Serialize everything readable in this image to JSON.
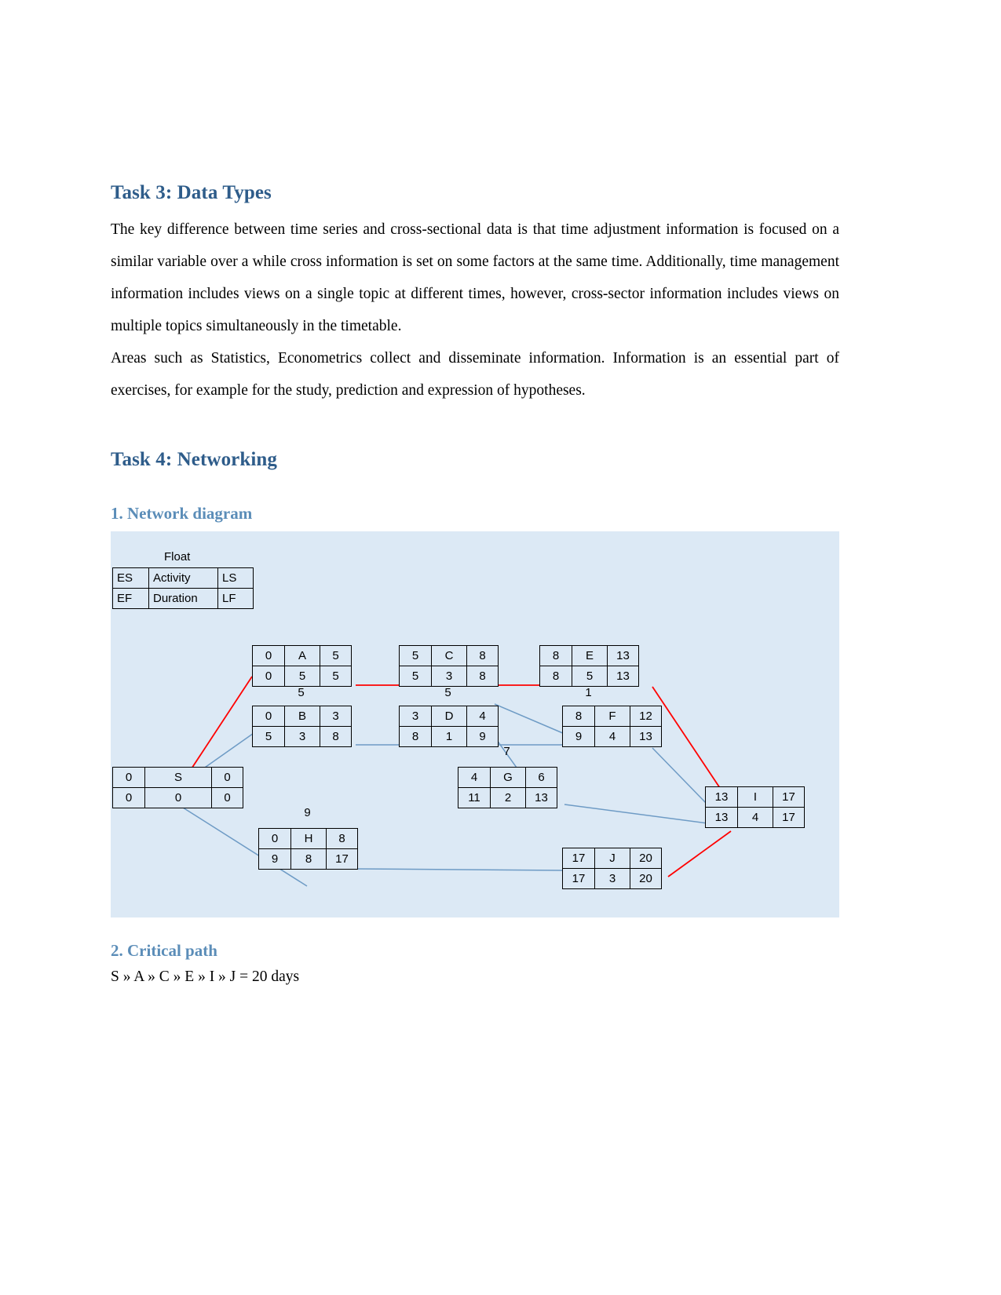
{
  "document": {
    "task3": {
      "heading": "Task 3: Data Types",
      "paragraph1": "The key difference between time series and cross-sectional data is that time adjustment information is focused on a similar variable over a while cross information is set on some factors at the same time. Additionally, time management information includes views on a single topic at different times, however, cross-sector information includes views on multiple topics simultaneously in the timetable.",
      "paragraph2": "Areas such as Statistics, Econometrics collect and disseminate information. Information is an essential part of exercises, for example for the study, prediction and expression of hypotheses."
    },
    "task4": {
      "heading": "Task 4: Networking",
      "section1_heading": "1. Network diagram",
      "section2_heading": "2. Critical path",
      "critical_path_text": "S » A » C » E » I » J = 20 days"
    }
  },
  "diagram": {
    "legend": {
      "float_label": "Float",
      "row1": [
        "ES",
        "Activity",
        "LS"
      ],
      "row2": [
        "EF",
        "Duration",
        "LF"
      ]
    },
    "colors": {
      "background": "#DCE9F5",
      "critical_edge": "#FF0000",
      "normal_edge": "#6E9BC5",
      "node_border": "#000000",
      "heading_primary": "#2E5C8A",
      "heading_secondary": "#5B8DB8"
    },
    "nodes": [
      {
        "id": "S",
        "es": "0",
        "activity": "S",
        "ls": "0",
        "ef": "0",
        "duration": "0",
        "lf": "0",
        "float": ""
      },
      {
        "id": "A",
        "es": "0",
        "activity": "A",
        "ls": "5",
        "ef": "0",
        "duration": "5",
        "lf": "5",
        "float": "5"
      },
      {
        "id": "B",
        "es": "0",
        "activity": "B",
        "ls": "3",
        "ef": "5",
        "duration": "3",
        "lf": "8",
        "float": ""
      },
      {
        "id": "C",
        "es": "5",
        "activity": "C",
        "ls": "8",
        "ef": "5",
        "duration": "3",
        "lf": "8",
        "float": "5"
      },
      {
        "id": "D",
        "es": "3",
        "activity": "D",
        "ls": "4",
        "ef": "8",
        "duration": "1",
        "lf": "9",
        "float": ""
      },
      {
        "id": "E",
        "es": "8",
        "activity": "E",
        "ls": "13",
        "ef": "8",
        "duration": "5",
        "lf": "13",
        "float": "1"
      },
      {
        "id": "F",
        "es": "8",
        "activity": "F",
        "ls": "12",
        "ef": "9",
        "duration": "4",
        "lf": "13",
        "float": ""
      },
      {
        "id": "G",
        "es": "4",
        "activity": "G",
        "ls": "6",
        "ef": "11",
        "duration": "2",
        "lf": "13",
        "float": "7"
      },
      {
        "id": "H",
        "es": "0",
        "activity": "H",
        "ls": "8",
        "ef": "9",
        "duration": "8",
        "lf": "17",
        "float": "9"
      },
      {
        "id": "I",
        "es": "13",
        "activity": "I",
        "ls": "17",
        "ef": "13",
        "duration": "4",
        "lf": "17",
        "float": ""
      },
      {
        "id": "J",
        "es": "17",
        "activity": "J",
        "ls": "20",
        "ef": "17",
        "duration": "3",
        "lf": "20",
        "float": ""
      }
    ]
  }
}
